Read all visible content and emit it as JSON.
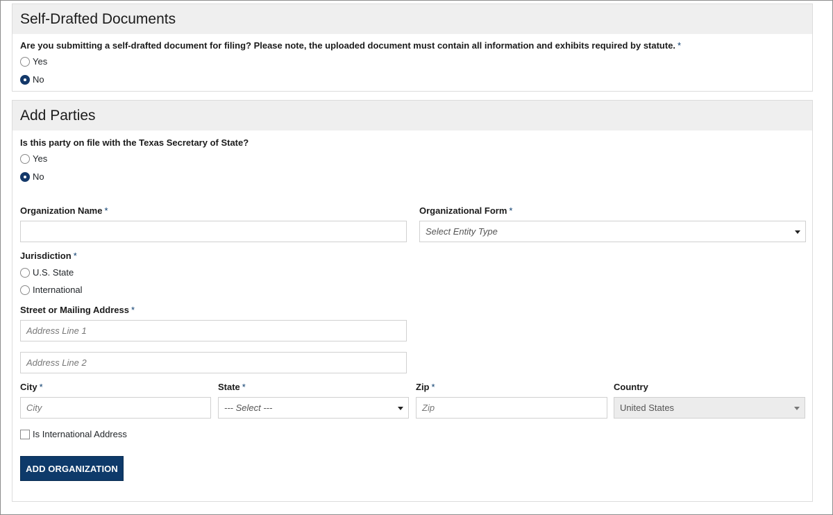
{
  "self_drafted": {
    "title": "Self-Drafted Documents",
    "question": "Are you submitting a self-drafted document for filing? Please note, the uploaded document must contain all information and exhibits required by statute.",
    "required_mark": "*",
    "options": [
      {
        "label": "Yes",
        "checked": false
      },
      {
        "label": "No",
        "checked": true
      }
    ]
  },
  "add_parties": {
    "title": "Add Parties",
    "question": "Is this party on file with the Texas Secretary of State?",
    "options": [
      {
        "label": "Yes",
        "checked": false
      },
      {
        "label": "No",
        "checked": true
      }
    ],
    "organization_name": {
      "label": "Organization Name",
      "required_mark": "*",
      "value": ""
    },
    "organizational_form": {
      "label": "Organizational Form",
      "required_mark": "*",
      "placeholder": "Select Entity Type"
    },
    "jurisdiction": {
      "label": "Jurisdiction",
      "required_mark": "*",
      "options": [
        {
          "label": "U.S. State",
          "checked": false
        },
        {
          "label": "International",
          "checked": false
        }
      ]
    },
    "address": {
      "label": "Street or Mailing Address",
      "required_mark": "*",
      "line1_placeholder": "Address Line 1",
      "line2_placeholder": "Address Line 2"
    },
    "city": {
      "label": "City",
      "required_mark": "*",
      "placeholder": "City"
    },
    "state": {
      "label": "State",
      "required_mark": "*",
      "placeholder": "--- Select ---"
    },
    "zip": {
      "label": "Zip",
      "required_mark": "*",
      "placeholder": "Zip"
    },
    "country": {
      "label": "Country",
      "value": "United States"
    },
    "international_checkbox": {
      "label": "Is International Address",
      "checked": false
    },
    "add_button": "ADD ORGANIZATION"
  },
  "colors": {
    "primary": "#0e3a6a",
    "header_bg": "#efefef",
    "required": "#0b3d6e"
  }
}
